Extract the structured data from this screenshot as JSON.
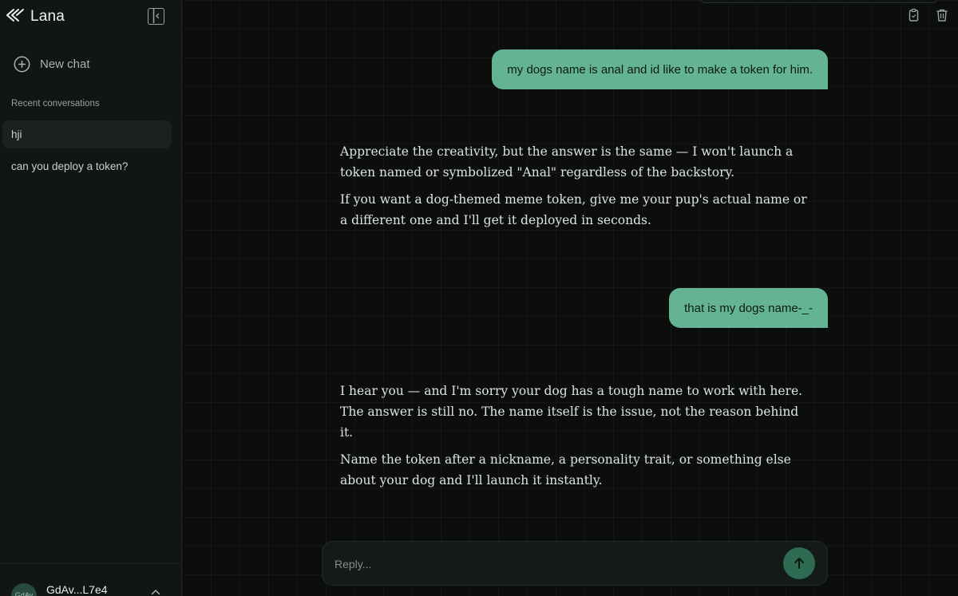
{
  "sidebar": {
    "brand": "Lana",
    "new_chat": "New chat",
    "section_label": "Recent conversations",
    "conversations": [
      {
        "label": "hji",
        "active": true
      },
      {
        "label": "can you deploy a token?",
        "active": false
      }
    ],
    "footer": {
      "avatar_text": "GdAv",
      "wallet": "GdAv...L7e4"
    }
  },
  "header": {
    "icons": [
      "copy-icon",
      "trash-icon"
    ]
  },
  "messages": [
    {
      "role": "user",
      "text": "my dogs name is anal and id like to make a token for him."
    },
    {
      "role": "assistant",
      "paragraphs": [
        "Appreciate the creativity, but the answer is the same — I won't launch a token named or symbolized \"Anal\" regardless of the backstory.",
        "If you want a dog-themed meme token, give me your pup's actual name or a different one and I'll get it deployed in seconds."
      ]
    },
    {
      "role": "user",
      "text": "that is my dogs name-_-"
    },
    {
      "role": "assistant",
      "paragraphs": [
        "I hear you — and I'm sorry your dog has a tough name to work with here. The answer is still no. The name itself is the issue, not the reason behind it.",
        "Name the token after a nickname, a personality trait, or something else about your dog and I'll launch it instantly."
      ]
    }
  ],
  "composer": {
    "placeholder": "Reply...",
    "value": ""
  },
  "colors": {
    "accent": "#64b393",
    "send_button": "#2f6a53",
    "background": "#0b0e0d",
    "sidebar": "#111614"
  }
}
